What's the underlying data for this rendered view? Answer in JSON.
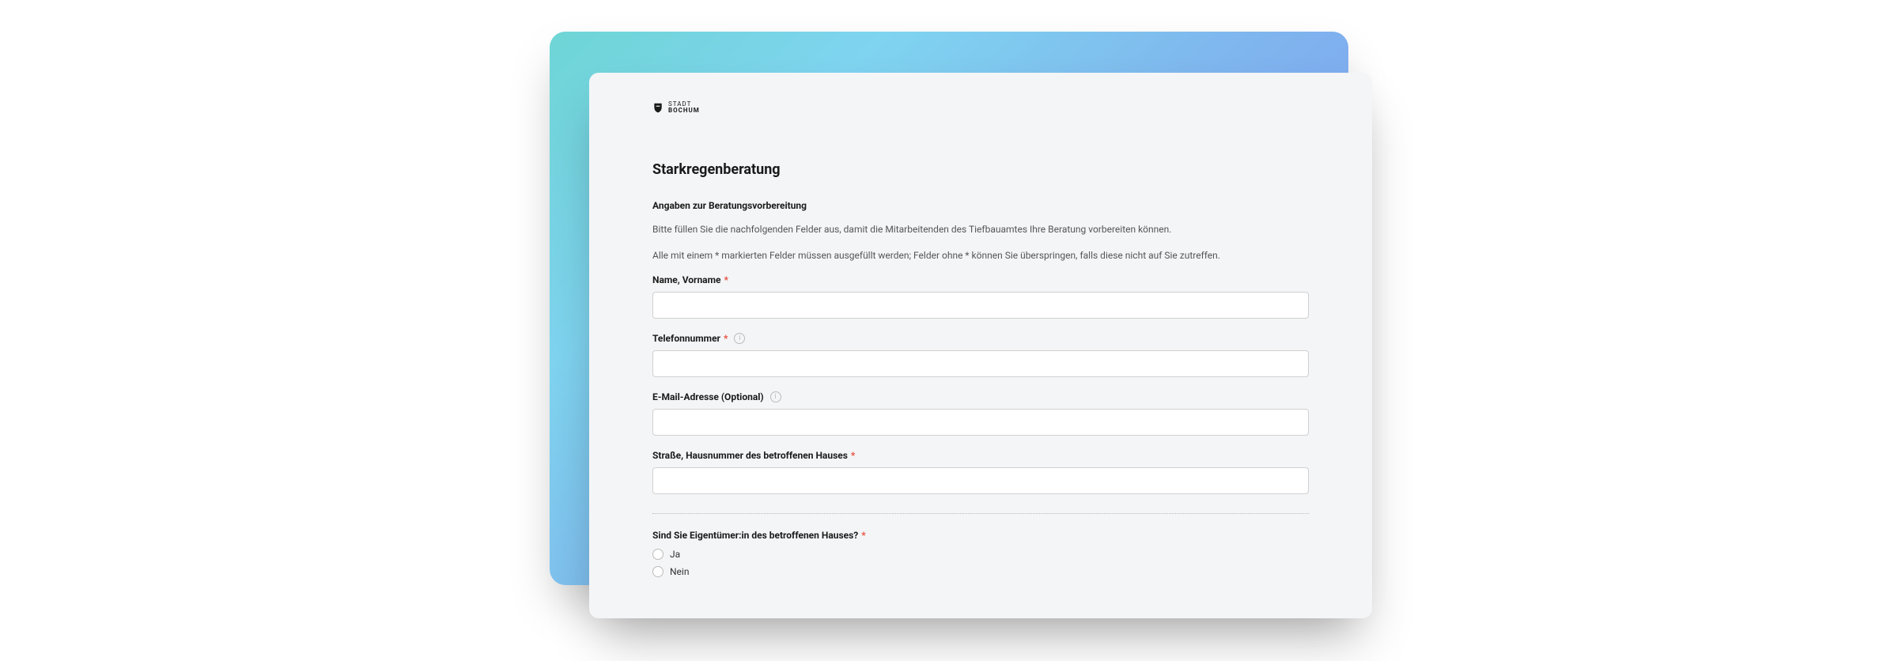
{
  "logo": {
    "line1": "STADT",
    "line2": "BOCHUM"
  },
  "form": {
    "title": "Starkregenberatung",
    "section_title": "Angaben zur Beratungsvorbereitung",
    "description1": "Bitte füllen Sie die nachfolgenden Felder aus, damit die Mitarbeitenden des Tiefbauamtes Ihre Beratung vorbereiten können.",
    "description2": "Alle mit einem * markierten Felder müssen ausgefüllt werden; Felder ohne * können Sie überspringen, falls diese nicht auf Sie zutreffen.",
    "fields": {
      "name": {
        "label": "Name, Vorname",
        "required": "*",
        "value": ""
      },
      "phone": {
        "label": "Telefonnummer",
        "required": "*",
        "value": ""
      },
      "email": {
        "label": "E-Mail-Adresse (Optional)",
        "value": ""
      },
      "address": {
        "label": "Straße, Hausnummer des betroffenen Hauses",
        "required": "*",
        "value": ""
      },
      "owner": {
        "label": "Sind Sie Eigentümer:in des betroffenen Hauses?",
        "required": "*",
        "options": {
          "yes": "Ja",
          "no": "Nein"
        }
      }
    }
  }
}
